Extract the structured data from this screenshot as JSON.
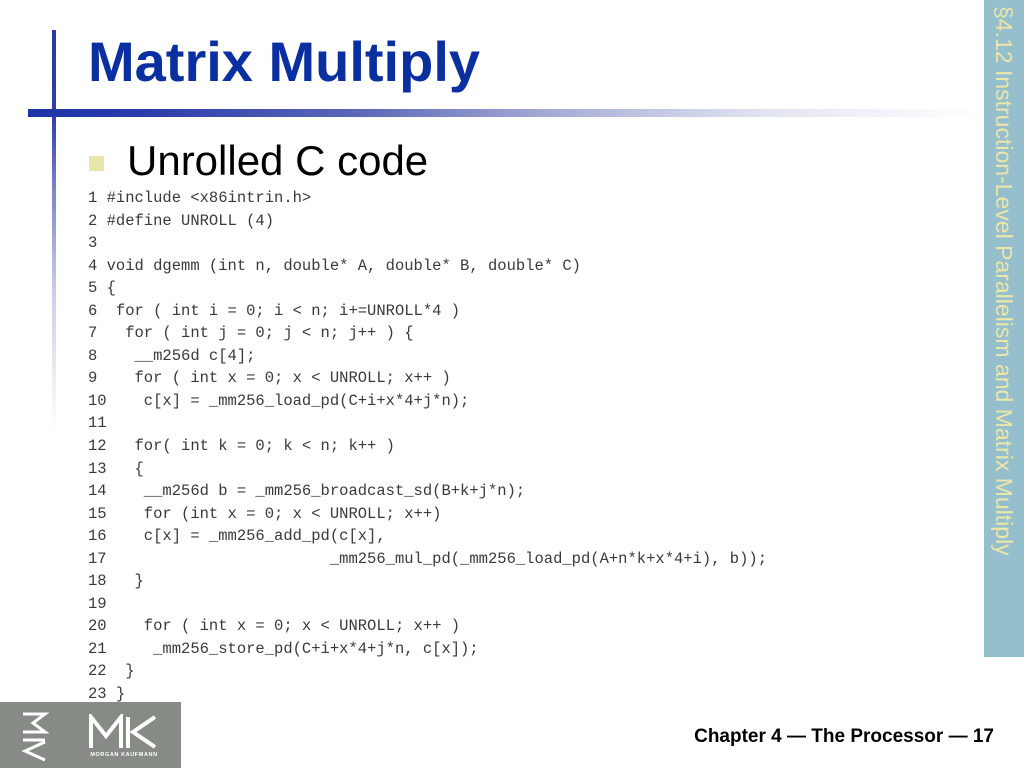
{
  "slide": {
    "title": "Matrix Multiply",
    "section_label": "§4.12 Instruction-Level Parallelism and Matrix Multiply",
    "bullet": {
      "icon": "square-bullet-icon",
      "text": "Unrolled C code"
    },
    "code_lines": [
      "1 #include <x86intrin.h>",
      "2 #define UNROLL (4)",
      "3",
      "4 void dgemm (int n, double* A, double* B, double* C)",
      "5 {",
      "6  for ( int i = 0; i < n; i+=UNROLL*4 )",
      "7   for ( int j = 0; j < n; j++ ) {",
      "8    __m256d c[4];",
      "9    for ( int x = 0; x < UNROLL; x++ )",
      "10    c[x] = _mm256_load_pd(C+i+x*4+j*n);",
      "11",
      "12   for( int k = 0; k < n; k++ )",
      "13   {",
      "14    __m256d b = _mm256_broadcast_sd(B+k+j*n);",
      "15    for (int x = 0; x < UNROLL; x++)",
      "16    c[x] = _mm256_add_pd(c[x],",
      "17                        _mm256_mul_pd(_mm256_load_pd(A+n*k+x*4+i), b));",
      "18   }",
      "19",
      "20    for ( int x = 0; x < UNROLL; x++ )",
      "21     _mm256_store_pd(C+i+x*4+j*n, c[x]);",
      "22  }",
      "23 }"
    ],
    "footer": "Chapter 4 — The Processor — 17",
    "logo": {
      "mark": "MK",
      "publisher": "MORGAN KAUFMANN"
    }
  },
  "colors": {
    "title": "#0a2fa0",
    "rule": "#1f33a6",
    "sidebar_bg": "#96bfcd",
    "sidebar_text": "#ece6a8",
    "bullet": "#e8e6ad",
    "logo_bg": "#878b86"
  }
}
